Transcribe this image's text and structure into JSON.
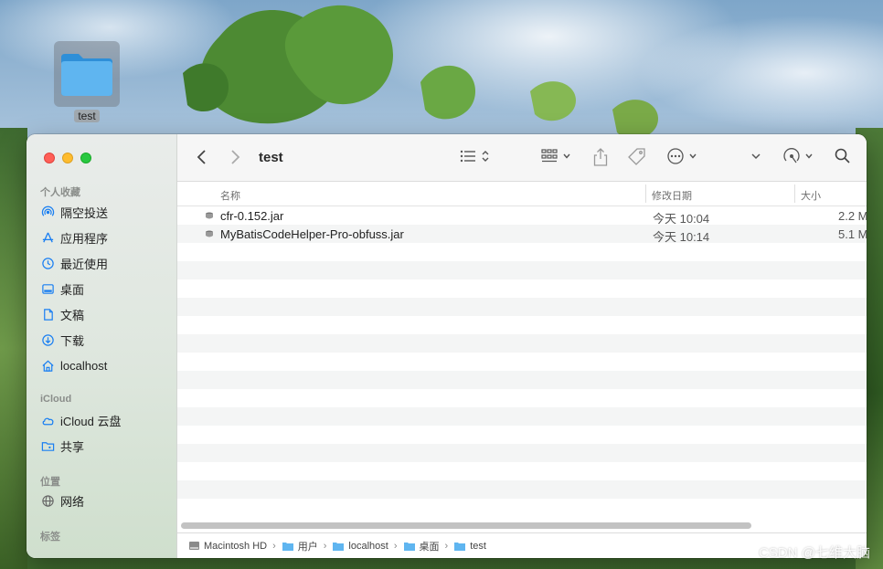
{
  "desktop": {
    "icon_label": "test"
  },
  "window": {
    "title": "test",
    "sidebar": {
      "favorites_header": "个人收藏",
      "favorites": [
        {
          "label": "隔空投送",
          "icon": "airdrop-icon"
        },
        {
          "label": "应用程序",
          "icon": "applications-icon"
        },
        {
          "label": "最近使用",
          "icon": "recents-icon"
        },
        {
          "label": "桌面",
          "icon": "desktop-icon"
        },
        {
          "label": "文稿",
          "icon": "documents-icon"
        },
        {
          "label": "下载",
          "icon": "downloads-icon"
        },
        {
          "label": "localhost",
          "icon": "home-icon"
        }
      ],
      "icloud_header": "iCloud",
      "icloud": [
        {
          "label": "iCloud 云盘",
          "icon": "icloud-icon"
        },
        {
          "label": "共享",
          "icon": "shared-folder-icon"
        }
      ],
      "locations_header": "位置",
      "locations": [
        {
          "label": "网络",
          "icon": "network-icon"
        }
      ],
      "tags_header": "标签"
    },
    "columns": {
      "name": "名称",
      "date": "修改日期",
      "size": "大小"
    },
    "files": [
      {
        "name": "cfr-0.152.jar",
        "date": "今天 10:04",
        "size": "2.2 M"
      },
      {
        "name": "MyBatisCodeHelper-Pro-obfuss.jar",
        "date": "今天 10:14",
        "size": "5.1 M"
      }
    ],
    "path": [
      "Macintosh HD",
      "用户",
      "localhost",
      "桌面",
      "test"
    ]
  },
  "watermark": "CSDN @七维大脑",
  "colors": {
    "folder_blue": "#4aa6e8",
    "close": "#ff5f57",
    "minimize": "#febc2e",
    "maximize": "#28c840",
    "accent": "#1a7ff2"
  }
}
